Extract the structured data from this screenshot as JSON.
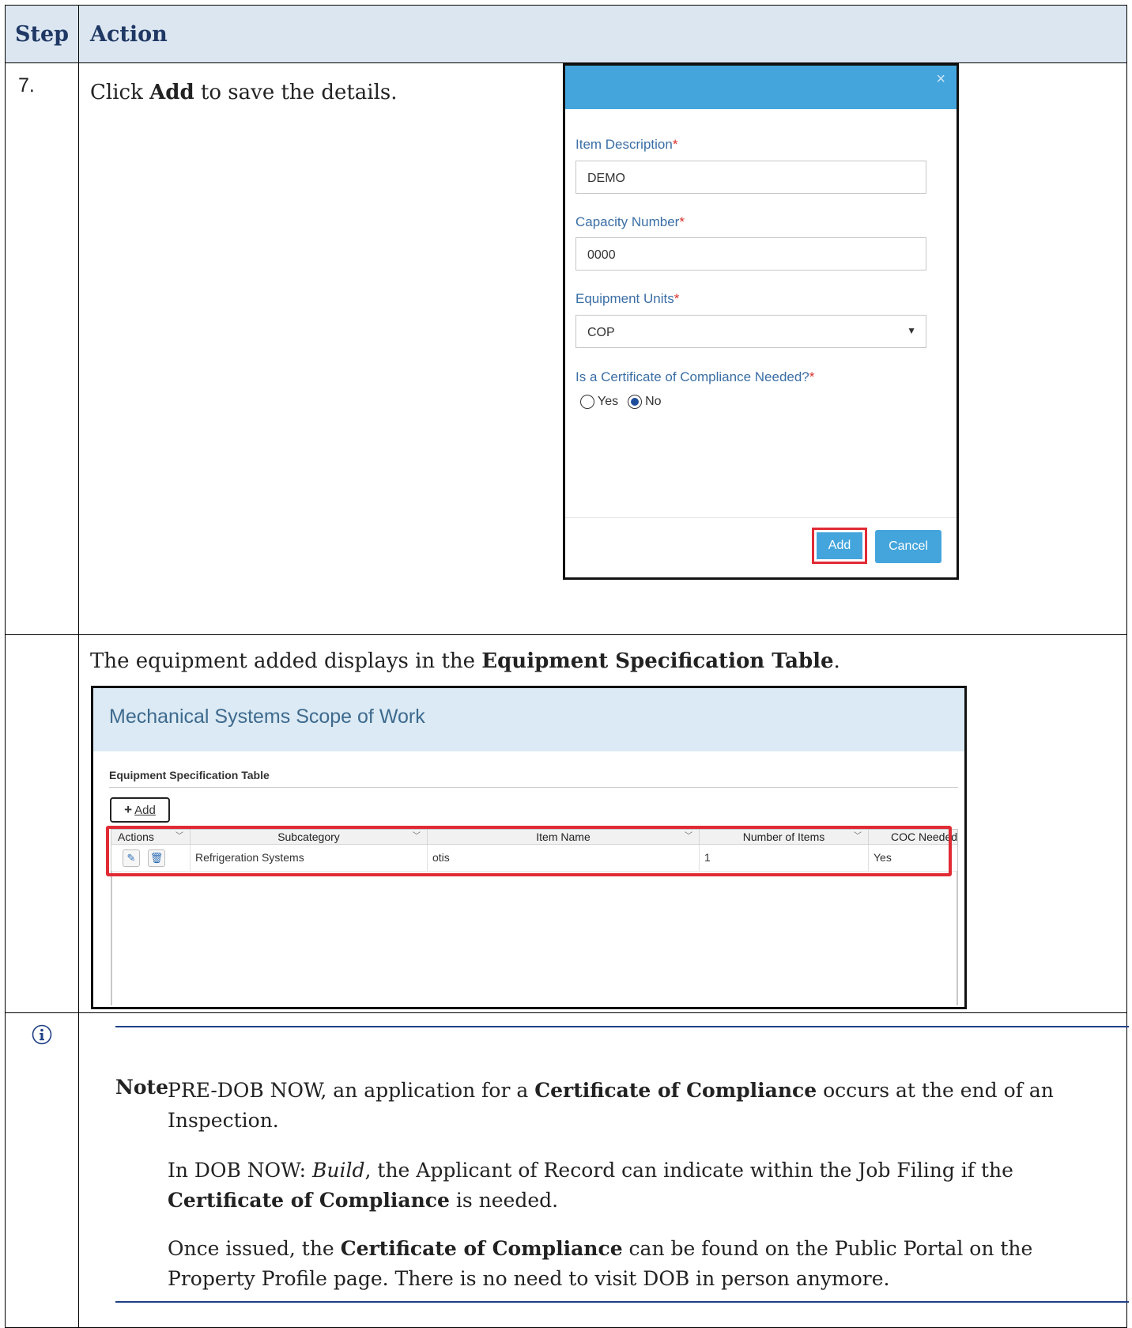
{
  "header": {
    "step": "Step",
    "action": "Action"
  },
  "step7": {
    "number": "7.",
    "instruction": {
      "pre": "Click ",
      "bold": "Add",
      "post": " to save the details."
    }
  },
  "modal": {
    "close": "×",
    "item_description": {
      "label": "Item Description",
      "value": "DEMO"
    },
    "capacity_number": {
      "label": "Capacity Number",
      "value": "0000"
    },
    "equipment_units": {
      "label": "Equipment Units",
      "value": "COP"
    },
    "coc_question": "Is a Certificate of Compliance Needed?",
    "required_marker": "*",
    "radio_yes": "Yes",
    "radio_no": "No",
    "selected": "No",
    "add_button": "Add",
    "cancel_button": "Cancel"
  },
  "result": {
    "text": {
      "pre": "The equipment added displays in the ",
      "bold": "Equipment Specification Table",
      "post": "."
    },
    "screenshot": {
      "title": "Mechanical Systems Scope of Work",
      "subtitle": "Equipment Specification Table",
      "add_button": "Add",
      "columns": [
        "Actions",
        "Subcategory",
        "Item Name",
        "Number of Items",
        "COC Needed"
      ],
      "rows": [
        {
          "subcategory": "Refrigeration Systems",
          "item_name": "otis",
          "number_of_items": "1",
          "coc_needed": "Yes"
        }
      ]
    }
  },
  "note": {
    "label": "Note",
    "p1": {
      "pre": "PRE-DOB NOW, an application for a ",
      "bold": "Certificate of Compliance",
      "post": " occurs at the end of an Inspection."
    },
    "p2": {
      "pre": "In DOB NOW: ",
      "italic": "Build",
      "mid": ", the Applicant of Record can indicate within the Job Filing if the ",
      "bold": "Certificate of Compliance",
      "post": " is needed."
    },
    "p3": {
      "pre": "Once issued, the ",
      "bold": "Certificate of Compliance",
      "post": " can be found on the Public Portal on the Property Profile page. There is no need to visit DOB in person anymore."
    }
  },
  "colors": {
    "header_bg": "#dce6f1",
    "modal_blue": "#44a5dc",
    "highlight_red": "#e02b35",
    "note_rule": "#1f3f86"
  }
}
